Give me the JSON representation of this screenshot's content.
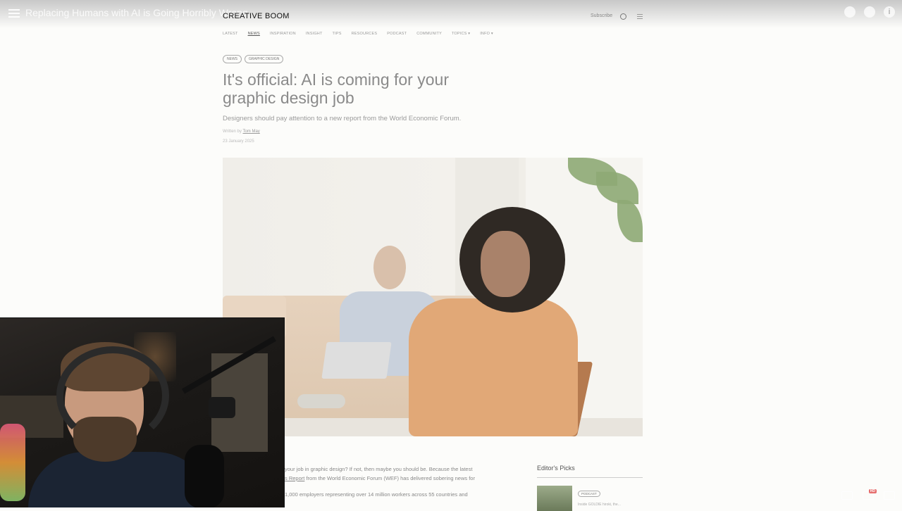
{
  "player": {
    "video_title": "Replacing Humans with AI is Going Horribly Wrong",
    "hd_badge": "HD"
  },
  "site": {
    "logo": "CREATIVE BOOM",
    "subscribe": "Subscribe",
    "nav": [
      "Latest",
      "News",
      "Inspiration",
      "Insight",
      "Tips",
      "Resources",
      "Podcast",
      "Community",
      "Topics ▾",
      "Info ▾"
    ],
    "active_nav_index": 1
  },
  "article": {
    "tags": [
      "News",
      "Graphic Design"
    ],
    "headline": "It's official: AI is coming for your graphic design job",
    "subhead": "Designers should pay attention to a new report from the World Economic Forum.",
    "written_by_label": "Written by",
    "author": "Tom May",
    "date": "23 January 2025",
    "body_line_1": "your job in graphic design? If not, then maybe you should be. Because the latest",
    "body_link": "s Report",
    "body_line_2": " from the World Economic Forum (WEF) has delivered sobering news for",
    "body_line_3": "1,000 employers representing over 14 million workers across 55 countries and"
  },
  "editors_picks": {
    "title": "Editor's Picks",
    "item_tag": "Podcast",
    "item_text": "Inside GOLDIE hiroki, the..."
  }
}
